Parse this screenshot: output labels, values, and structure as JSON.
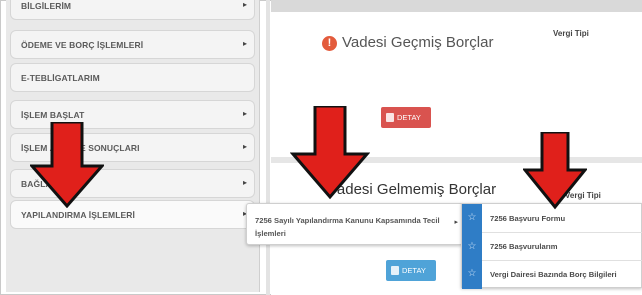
{
  "sidebar": {
    "items": [
      {
        "label": "BİLGİLERİM",
        "has_arrow": true
      },
      {
        "label": "ÖDEME VE BORÇ İŞLEMLERİ",
        "has_arrow": true
      },
      {
        "label": "E-TEBLİGATLARIM",
        "has_arrow": false
      },
      {
        "label": "İŞLEM BAŞLAT",
        "has_arrow": true
      },
      {
        "label": "İŞLEM                    ARIM VE SONUÇLARI",
        "has_arrow": true
      },
      {
        "label": "BAĞLA",
        "has_arrow": true
      },
      {
        "label": "YAPILANDIRMA İŞLEMLERİ",
        "has_arrow": true
      }
    ],
    "arrow_glyph": "▸"
  },
  "overdue": {
    "icon": "!",
    "title": "Vadesi Geçmiş Borçlar",
    "column_header": "Vergi Tipi",
    "detail_button": "DETAY"
  },
  "not_due": {
    "title": "Vadesi Gelmemiş Borçlar",
    "column_header": "Vergi Tipi",
    "detail_button": "DETAY"
  },
  "flyout_level1": {
    "text": "7256 Sayılı Yapılandırma Kanunu Kapsamında Tecil İşlemleri",
    "arrow_glyph": "▸"
  },
  "flyout_level2": {
    "star_glyph": "☆",
    "items": [
      {
        "label": "7256 Başvuru Formu"
      },
      {
        "label": "7256 Başvurularım"
      },
      {
        "label": "Vergi Dairesi Bazında Borç Bilgileri"
      }
    ]
  },
  "colors": {
    "sidebar_bg": "#e9e9e9",
    "button_red": "#d9534f",
    "button_blue": "#4fa3d8",
    "star_column": "#2f7dc6",
    "annotation_arrow": "#e0201b",
    "warning_icon": "#e35b3c"
  }
}
